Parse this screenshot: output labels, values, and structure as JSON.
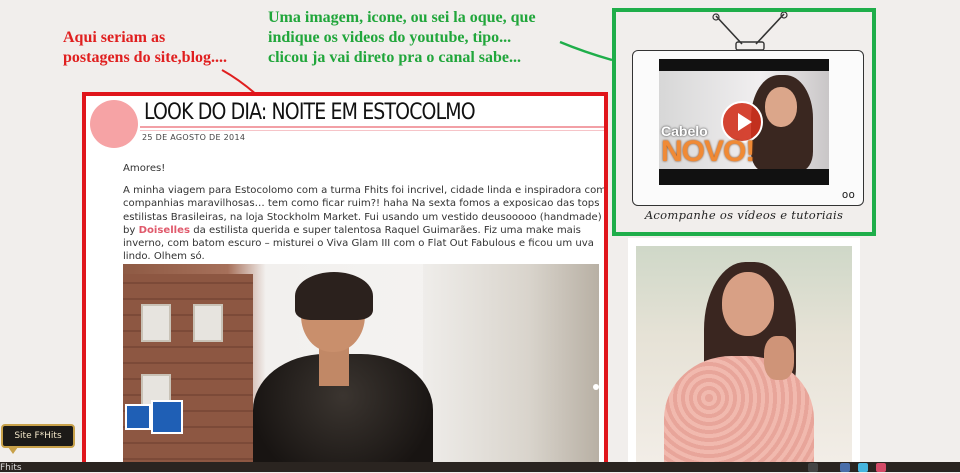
{
  "annotations": {
    "red_note": [
      "Aqui seriam as",
      "postagens do site,blog...."
    ],
    "green_note": [
      "Uma imagem, icone, ou sei la oque, que",
      "indique os videos do youtube, tipo...",
      "clicou ja vai direto pra o canal sabe..."
    ],
    "red_color": "#e0151b",
    "green_color": "#1fae4a"
  },
  "post": {
    "title": "LOOK DO DIA: NOITE EM ESTOCOLMO",
    "date": "25 DE AGOSTO DE 2014",
    "greeting": "Amores!",
    "paragraph_before_link": "A minha viagem para Estocolomo com a turma Fhits foi incrivel, cidade linda e inspiradora com companhias maravilhosas… tem como ficar ruim?! haha Na sexta fomos a exposicao das tops estilistas Brasileiras, na loja Stockholm Market. Fui usando um vestido deusooooo (handmade) by ",
    "link_text": "Doiselles",
    "paragraph_after_link": " da estilista querida e super talentosa Raquel Guimarães. Fiz uma make mais inverno, com batom escuro – misturei o Viva Glam III com o Flat Out Fabulous e ficou um uva lindo. Olhem só.",
    "accent_color": "#f6a3a5"
  },
  "youtube_widget": {
    "thumb_text_top": "Cabelo",
    "thumb_text_big": "NOVO!",
    "knobs": "oo",
    "caption": "Acompanhe os vídeos e tutoriais"
  },
  "footer": {
    "tooltip": "Site F*Hits",
    "bar_text": "Fhits"
  },
  "icons": [
    "play-icon",
    "tv-antenna-icon",
    "social-icon"
  ]
}
